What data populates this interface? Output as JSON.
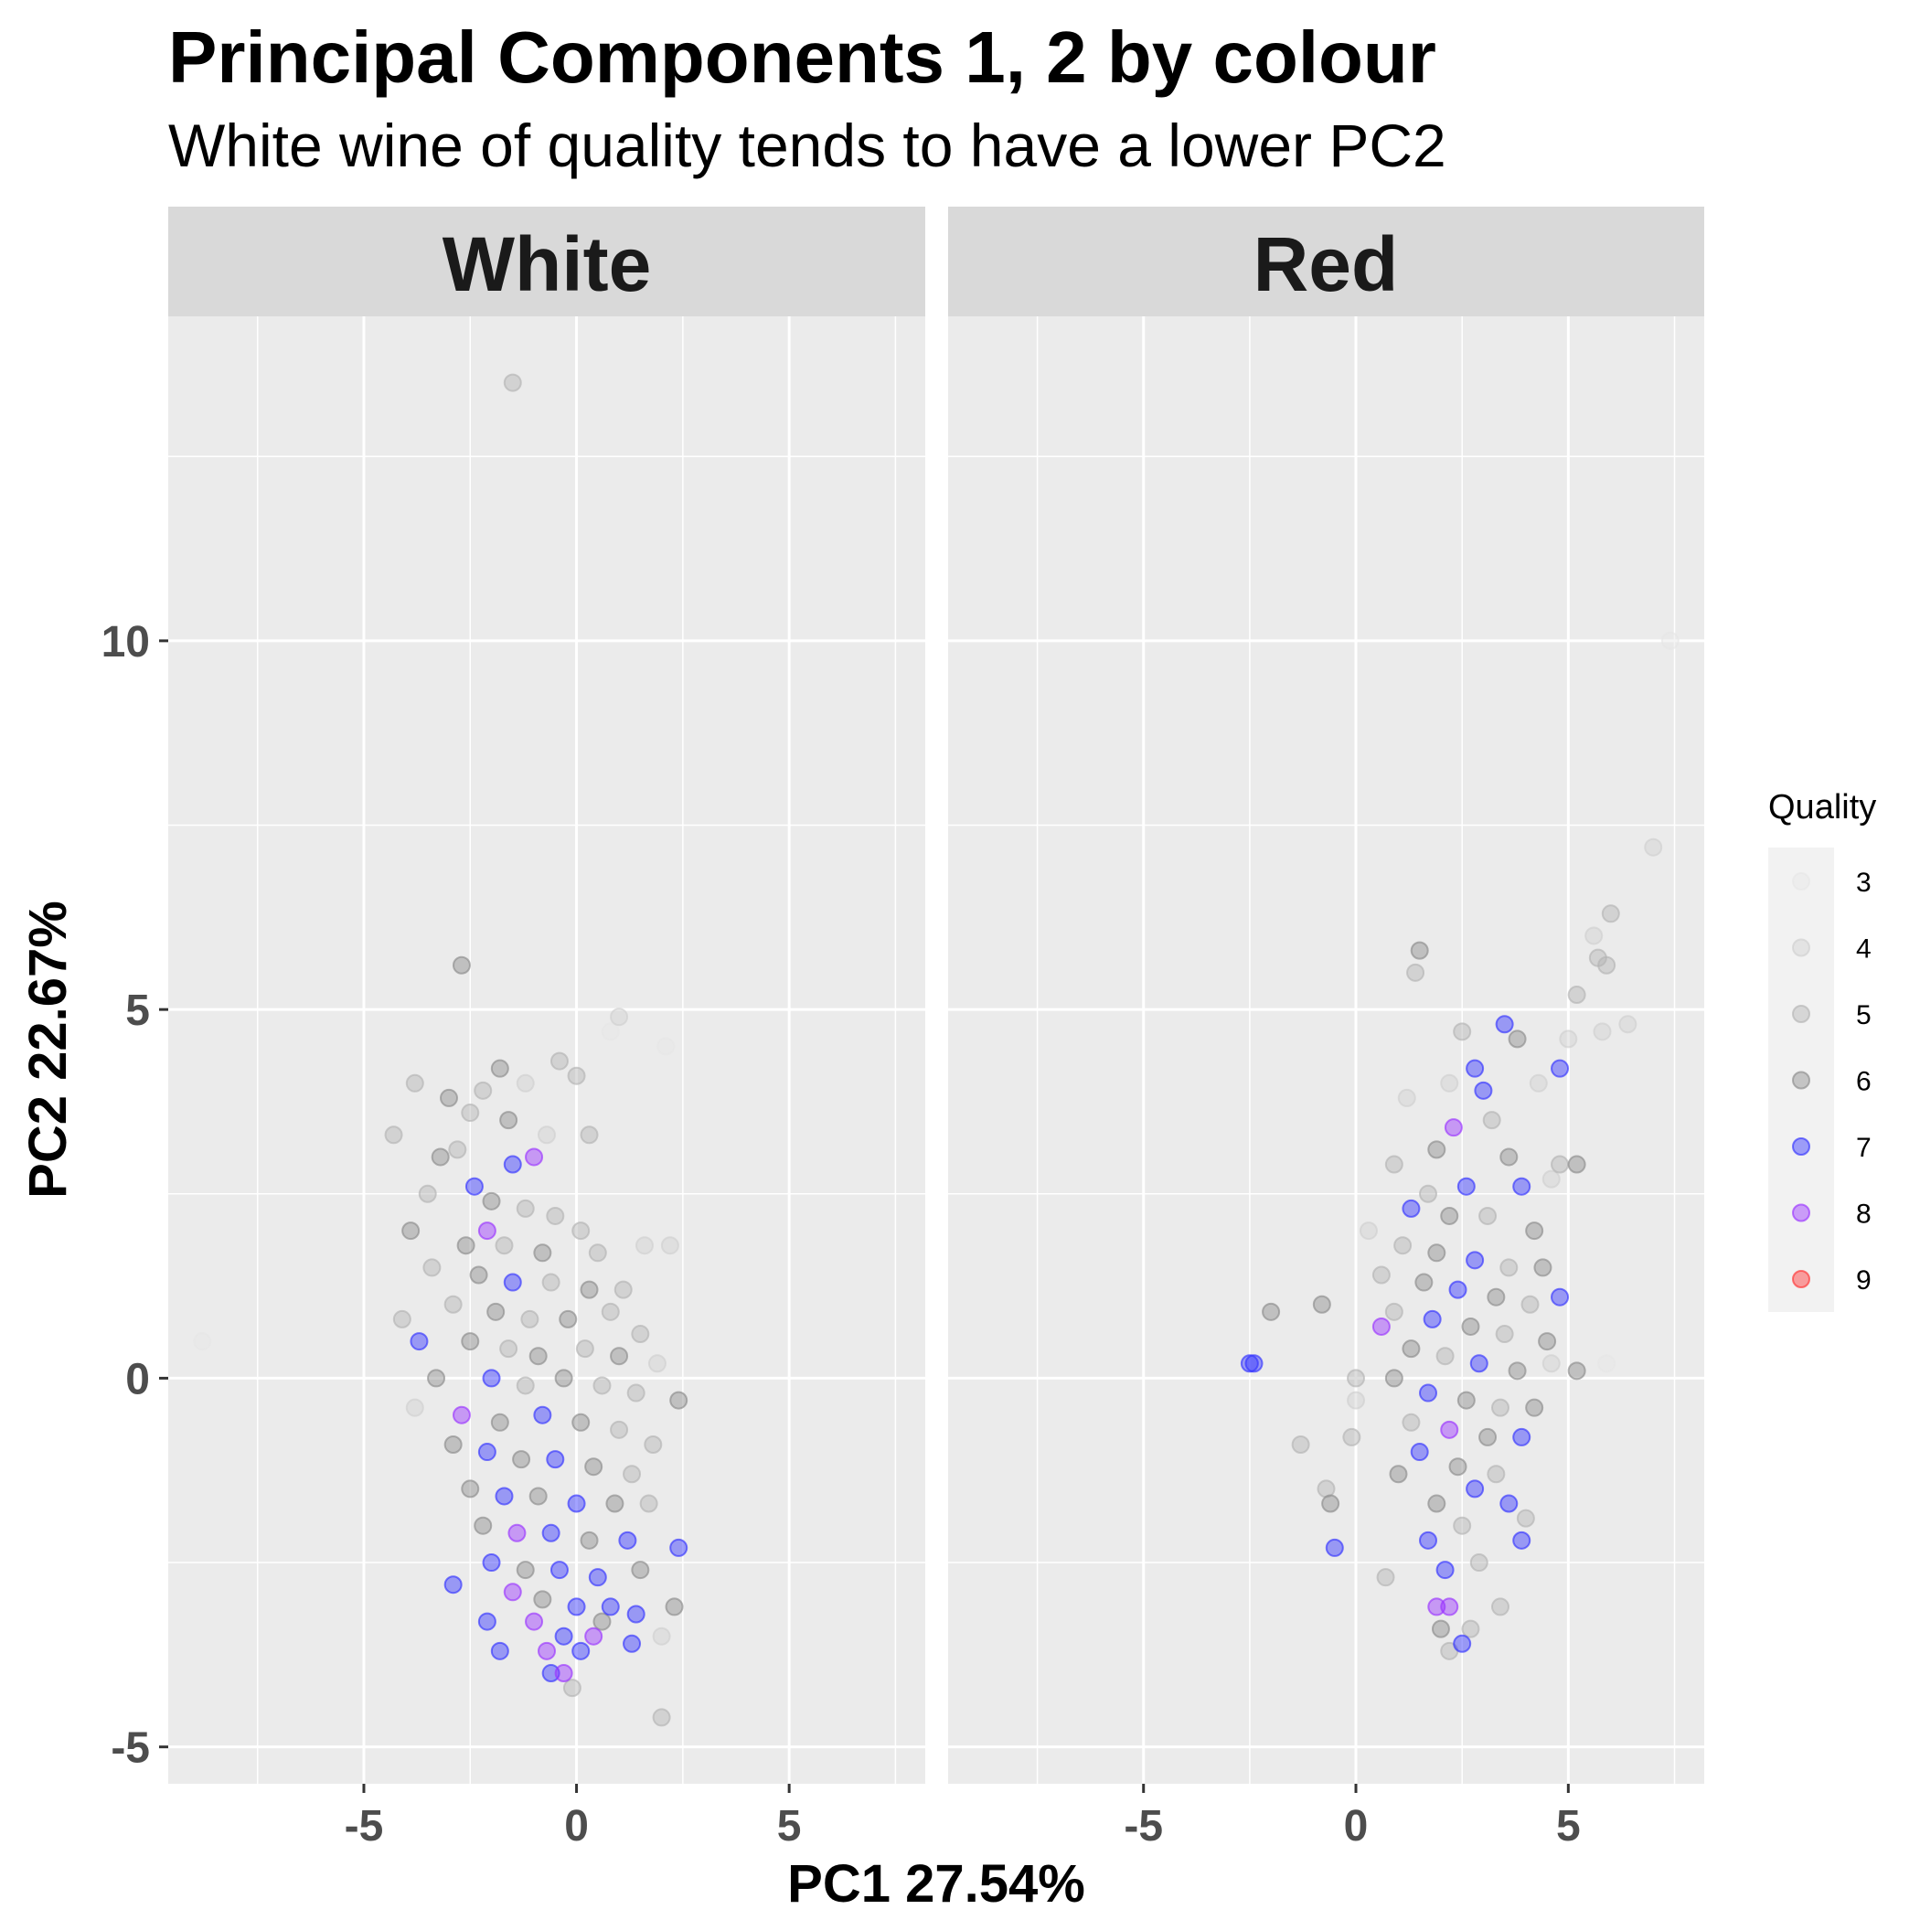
{
  "chart_data": {
    "type": "scatter",
    "title": "Principal Components 1, 2 by colour",
    "subtitle": "White wine of quality tends to have a lower PC2",
    "xlabel": "PC1 27.54%",
    "ylabel": "PC2 22.67%",
    "xlim": [
      -9.6,
      8.2
    ],
    "ylim": [
      -5.5,
      14.4
    ],
    "x_ticks": [
      -5,
      0,
      5
    ],
    "y_ticks": [
      -5,
      0,
      5,
      10
    ],
    "x_tick_labels": [
      "-5",
      "0",
      "5"
    ],
    "y_tick_labels": [
      "-5",
      "0",
      "5",
      "10"
    ],
    "grid": true,
    "legend": {
      "title": "Quality",
      "placement": "right",
      "entries": [
        {
          "label": "3",
          "color": "#e6e6e6"
        },
        {
          "label": "4",
          "color": "#d0d0d0"
        },
        {
          "label": "5",
          "color": "#b3b3b3"
        },
        {
          "label": "6",
          "color": "#8c8c8c"
        },
        {
          "label": "7",
          "color": "#3333ff"
        },
        {
          "label": "8",
          "color": "#9933ff"
        },
        {
          "label": "9",
          "color": "#ff3333"
        }
      ]
    },
    "point_alpha": 0.45,
    "facets": [
      {
        "label": "White",
        "note": "representative sample of plotted points [PC1, PC2, quality]",
        "points": [
          [
            -1.5,
            13.5,
            5
          ],
          [
            -8.8,
            0.5,
            3
          ],
          [
            -2.7,
            5.6,
            6
          ],
          [
            1.0,
            4.9,
            4
          ],
          [
            0.8,
            4.7,
            3
          ],
          [
            2.1,
            4.5,
            3
          ],
          [
            -0.4,
            4.3,
            5
          ],
          [
            -1.8,
            4.2,
            6
          ],
          [
            0.0,
            4.1,
            5
          ],
          [
            -3.8,
            4.0,
            5
          ],
          [
            -1.2,
            4.0,
            4
          ],
          [
            -2.2,
            3.9,
            5
          ],
          [
            -3.0,
            3.8,
            6
          ],
          [
            -2.5,
            3.6,
            5
          ],
          [
            -1.6,
            3.5,
            6
          ],
          [
            0.3,
            3.3,
            5
          ],
          [
            -4.3,
            3.3,
            5
          ],
          [
            -0.7,
            3.3,
            4
          ],
          [
            -2.8,
            3.1,
            5
          ],
          [
            -3.2,
            3.0,
            6
          ],
          [
            -1.0,
            3.0,
            8
          ],
          [
            -1.5,
            2.9,
            7
          ],
          [
            -3.5,
            2.5,
            5
          ],
          [
            -2.4,
            2.6,
            7
          ],
          [
            -2.0,
            2.4,
            6
          ],
          [
            -1.2,
            2.3,
            5
          ],
          [
            -0.5,
            2.2,
            5
          ],
          [
            0.1,
            2.0,
            5
          ],
          [
            -3.9,
            2.0,
            6
          ],
          [
            -2.1,
            2.0,
            8
          ],
          [
            -2.6,
            1.8,
            6
          ],
          [
            -1.7,
            1.8,
            5
          ],
          [
            -0.8,
            1.7,
            6
          ],
          [
            0.5,
            1.7,
            5
          ],
          [
            1.6,
            1.8,
            4
          ],
          [
            2.2,
            1.8,
            4
          ],
          [
            -3.4,
            1.5,
            5
          ],
          [
            -2.3,
            1.4,
            6
          ],
          [
            -1.5,
            1.3,
            7
          ],
          [
            -0.6,
            1.3,
            5
          ],
          [
            0.3,
            1.2,
            6
          ],
          [
            1.1,
            1.2,
            5
          ],
          [
            -2.9,
            1.0,
            5
          ],
          [
            -1.9,
            0.9,
            6
          ],
          [
            -1.1,
            0.8,
            5
          ],
          [
            -0.2,
            0.8,
            6
          ],
          [
            0.8,
            0.9,
            5
          ],
          [
            1.5,
            0.6,
            5
          ],
          [
            -4.1,
            0.8,
            5
          ],
          [
            -3.7,
            0.5,
            7
          ],
          [
            -2.5,
            0.5,
            6
          ],
          [
            -1.6,
            0.4,
            5
          ],
          [
            -0.9,
            0.3,
            6
          ],
          [
            0.2,
            0.4,
            5
          ],
          [
            1.0,
            0.3,
            6
          ],
          [
            1.9,
            0.2,
            4
          ],
          [
            -3.3,
            0.0,
            6
          ],
          [
            -2.0,
            0.0,
            7
          ],
          [
            -1.2,
            -0.1,
            5
          ],
          [
            -0.3,
            0.0,
            6
          ],
          [
            0.6,
            -0.1,
            5
          ],
          [
            1.4,
            -0.2,
            5
          ],
          [
            2.4,
            -0.3,
            6
          ],
          [
            -3.8,
            -0.4,
            4
          ],
          [
            -2.7,
            -0.5,
            8
          ],
          [
            -1.8,
            -0.6,
            6
          ],
          [
            -0.8,
            -0.5,
            7
          ],
          [
            0.1,
            -0.6,
            6
          ],
          [
            1.0,
            -0.7,
            5
          ],
          [
            1.8,
            -0.9,
            5
          ],
          [
            -2.9,
            -0.9,
            6
          ],
          [
            -2.1,
            -1.0,
            7
          ],
          [
            -1.3,
            -1.1,
            6
          ],
          [
            -0.5,
            -1.1,
            7
          ],
          [
            0.4,
            -1.2,
            6
          ],
          [
            1.3,
            -1.3,
            5
          ],
          [
            -2.5,
            -1.5,
            6
          ],
          [
            -1.7,
            -1.6,
            7
          ],
          [
            -0.9,
            -1.6,
            6
          ],
          [
            0.0,
            -1.7,
            7
          ],
          [
            0.9,
            -1.7,
            6
          ],
          [
            1.7,
            -1.7,
            5
          ],
          [
            -2.2,
            -2.0,
            6
          ],
          [
            -1.4,
            -2.1,
            8
          ],
          [
            -0.6,
            -2.1,
            7
          ],
          [
            0.3,
            -2.2,
            6
          ],
          [
            1.2,
            -2.2,
            7
          ],
          [
            2.4,
            -2.3,
            7
          ],
          [
            -2.0,
            -2.5,
            7
          ],
          [
            -1.2,
            -2.6,
            6
          ],
          [
            -0.4,
            -2.6,
            7
          ],
          [
            0.5,
            -2.7,
            7
          ],
          [
            1.5,
            -2.6,
            6
          ],
          [
            -2.9,
            -2.8,
            7
          ],
          [
            -1.5,
            -2.9,
            8
          ],
          [
            -0.8,
            -3.0,
            6
          ],
          [
            0.0,
            -3.1,
            7
          ],
          [
            0.8,
            -3.1,
            7
          ],
          [
            1.4,
            -3.2,
            7
          ],
          [
            2.3,
            -3.1,
            6
          ],
          [
            -2.1,
            -3.3,
            7
          ],
          [
            -1.0,
            -3.3,
            8
          ],
          [
            -0.3,
            -3.5,
            7
          ],
          [
            0.4,
            -3.5,
            8
          ],
          [
            1.3,
            -3.6,
            7
          ],
          [
            2.0,
            -3.5,
            4
          ],
          [
            -1.8,
            -3.7,
            7
          ],
          [
            -0.7,
            -3.7,
            8
          ],
          [
            0.1,
            -3.7,
            7
          ],
          [
            -0.6,
            -4.0,
            7
          ],
          [
            -0.1,
            -4.2,
            5
          ],
          [
            2.0,
            -4.6,
            5
          ],
          [
            -0.3,
            -4.0,
            8
          ],
          [
            0.6,
            -3.3,
            6
          ]
        ]
      },
      {
        "label": "Red",
        "note": "representative sample of plotted points [PC1, PC2, quality]",
        "points": [
          [
            7.4,
            10.0,
            3
          ],
          [
            7.0,
            7.2,
            4
          ],
          [
            6.0,
            6.3,
            5
          ],
          [
            5.6,
            6.0,
            4
          ],
          [
            5.7,
            5.7,
            5
          ],
          [
            5.9,
            5.6,
            5
          ],
          [
            5.2,
            5.2,
            5
          ],
          [
            6.4,
            4.8,
            4
          ],
          [
            5.8,
            4.7,
            4
          ],
          [
            1.5,
            5.8,
            6
          ],
          [
            1.4,
            5.5,
            5
          ],
          [
            2.5,
            4.7,
            5
          ],
          [
            5.0,
            4.6,
            4
          ],
          [
            3.8,
            4.6,
            6
          ],
          [
            3.5,
            4.8,
            7
          ],
          [
            2.8,
            4.2,
            7
          ],
          [
            2.2,
            4.0,
            4
          ],
          [
            3.0,
            3.9,
            7
          ],
          [
            4.3,
            4.0,
            4
          ],
          [
            4.8,
            4.2,
            7
          ],
          [
            1.2,
            3.8,
            4
          ],
          [
            3.2,
            3.5,
            5
          ],
          [
            2.3,
            3.4,
            8
          ],
          [
            1.9,
            3.1,
            6
          ],
          [
            3.6,
            3.0,
            6
          ],
          [
            4.8,
            2.9,
            5
          ],
          [
            5.2,
            2.9,
            6
          ],
          [
            0.9,
            2.9,
            5
          ],
          [
            2.6,
            2.6,
            7
          ],
          [
            1.7,
            2.5,
            5
          ],
          [
            3.9,
            2.6,
            7
          ],
          [
            4.6,
            2.7,
            4
          ],
          [
            1.3,
            2.3,
            7
          ],
          [
            2.2,
            2.2,
            6
          ],
          [
            3.1,
            2.2,
            5
          ],
          [
            4.2,
            2.0,
            6
          ],
          [
            0.3,
            2.0,
            4
          ],
          [
            1.1,
            1.8,
            5
          ],
          [
            1.9,
            1.7,
            6
          ],
          [
            2.8,
            1.6,
            7
          ],
          [
            3.6,
            1.5,
            5
          ],
          [
            4.4,
            1.5,
            6
          ],
          [
            0.6,
            1.4,
            5
          ],
          [
            1.6,
            1.3,
            6
          ],
          [
            2.4,
            1.2,
            7
          ],
          [
            3.3,
            1.1,
            6
          ],
          [
            4.1,
            1.0,
            5
          ],
          [
            4.8,
            1.1,
            7
          ],
          [
            -2.0,
            0.9,
            6
          ],
          [
            -0.8,
            1.0,
            6
          ],
          [
            0.9,
            0.9,
            5
          ],
          [
            1.8,
            0.8,
            7
          ],
          [
            2.7,
            0.7,
            6
          ],
          [
            3.5,
            0.6,
            5
          ],
          [
            4.5,
            0.5,
            6
          ],
          [
            0.6,
            0.7,
            8
          ],
          [
            -2.5,
            0.2,
            7
          ],
          [
            -2.4,
            0.2,
            7
          ],
          [
            1.3,
            0.4,
            6
          ],
          [
            2.1,
            0.3,
            5
          ],
          [
            2.9,
            0.2,
            7
          ],
          [
            3.8,
            0.1,
            6
          ],
          [
            4.6,
            0.2,
            4
          ],
          [
            5.2,
            0.1,
            6
          ],
          [
            5.9,
            0.2,
            3
          ],
          [
            0.0,
            0.0,
            5
          ],
          [
            0.9,
            0.0,
            6
          ],
          [
            1.7,
            -0.2,
            7
          ],
          [
            2.6,
            -0.3,
            6
          ],
          [
            3.4,
            -0.4,
            5
          ],
          [
            4.2,
            -0.4,
            6
          ],
          [
            0.0,
            -0.3,
            4
          ],
          [
            1.3,
            -0.6,
            5
          ],
          [
            2.2,
            -0.7,
            8
          ],
          [
            3.1,
            -0.8,
            6
          ],
          [
            3.9,
            -0.8,
            7
          ],
          [
            -1.3,
            -0.9,
            5
          ],
          [
            -0.1,
            -0.8,
            5
          ],
          [
            1.5,
            -1.0,
            7
          ],
          [
            2.4,
            -1.2,
            6
          ],
          [
            3.3,
            -1.3,
            5
          ],
          [
            1.0,
            -1.3,
            6
          ],
          [
            2.8,
            -1.5,
            7
          ],
          [
            -0.7,
            -1.5,
            5
          ],
          [
            -0.6,
            -1.7,
            6
          ],
          [
            1.9,
            -1.7,
            6
          ],
          [
            3.6,
            -1.7,
            7
          ],
          [
            2.5,
            -2.0,
            5
          ],
          [
            4.0,
            -1.9,
            5
          ],
          [
            -0.5,
            -2.3,
            7
          ],
          [
            1.7,
            -2.2,
            7
          ],
          [
            3.9,
            -2.2,
            7
          ],
          [
            0.7,
            -2.7,
            5
          ],
          [
            2.1,
            -2.6,
            7
          ],
          [
            2.9,
            -2.5,
            5
          ],
          [
            3.4,
            -3.1,
            5
          ],
          [
            1.9,
            -3.1,
            8
          ],
          [
            2.2,
            -3.1,
            8
          ],
          [
            2.0,
            -3.4,
            6
          ],
          [
            2.5,
            -3.6,
            7
          ],
          [
            2.2,
            -3.7,
            5
          ],
          [
            2.7,
            -3.4,
            5
          ]
        ]
      }
    ]
  }
}
